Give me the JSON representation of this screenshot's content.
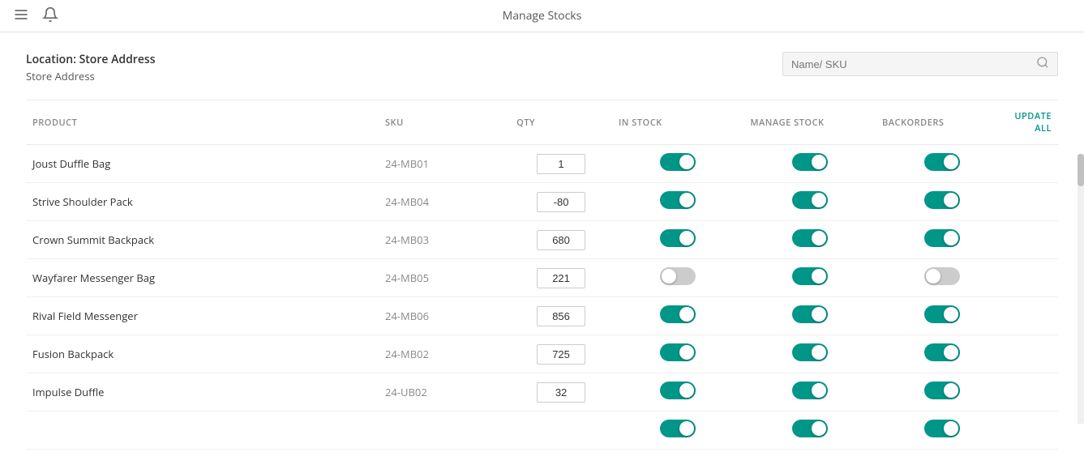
{
  "topbar": {
    "title": "Manage Stocks",
    "hamburger_label": "Menu",
    "bell_label": "Notifications"
  },
  "location": {
    "label": "Location: Store Address",
    "sublabel": "Store Address"
  },
  "search": {
    "placeholder": "Name/ SKU"
  },
  "table": {
    "columns": {
      "product": "PRODUCT",
      "sku": "SKU",
      "qty": "QTY",
      "instock": "IN STOCK",
      "managestock": "MANAGE STOCK",
      "backorders": "BACKORDERS",
      "updateall": "UPDATE ALL"
    },
    "rows": [
      {
        "id": 1,
        "product": "Joust Duffle Bag",
        "sku": "24-MB01",
        "qty": "1",
        "instock": "on",
        "managestock": "on",
        "backorders": "on"
      },
      {
        "id": 2,
        "product": "Strive Shoulder Pack",
        "sku": "24-MB04",
        "qty": "-80",
        "instock": "on",
        "managestock": "on",
        "backorders": "on"
      },
      {
        "id": 3,
        "product": "Crown Summit Backpack",
        "sku": "24-MB03",
        "qty": "680",
        "instock": "on",
        "managestock": "on",
        "backorders": "on"
      },
      {
        "id": 4,
        "product": "Wayfarer Messenger Bag",
        "sku": "24-MB05",
        "qty": "221",
        "instock": "off",
        "managestock": "on",
        "backorders": "off"
      },
      {
        "id": 5,
        "product": "Rival Field Messenger",
        "sku": "24-MB06",
        "qty": "856",
        "instock": "on",
        "managestock": "on",
        "backorders": "on"
      },
      {
        "id": 6,
        "product": "Fusion Backpack",
        "sku": "24-MB02",
        "qty": "725",
        "instock": "on",
        "managestock": "on",
        "backorders": "on"
      },
      {
        "id": 7,
        "product": "Impulse Duffle",
        "sku": "24-UB02",
        "qty": "32",
        "instock": "on",
        "managestock": "on",
        "backorders": "on"
      },
      {
        "id": 8,
        "product": "",
        "sku": "",
        "qty": "",
        "instock": "on",
        "managestock": "on",
        "backorders": "on"
      }
    ]
  },
  "colors": {
    "toggle_on": "#009688",
    "toggle_off": "#cccccc",
    "accent": "#009688"
  }
}
